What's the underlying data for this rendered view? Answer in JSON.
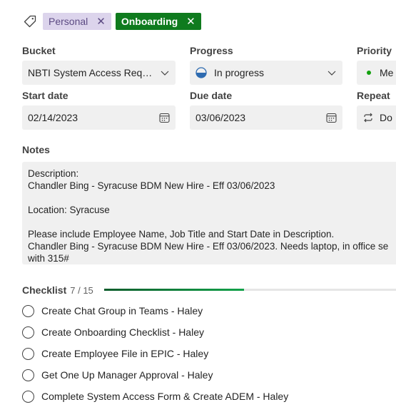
{
  "labels": [
    {
      "text": "Personal",
      "remove_icon": "close-icon"
    },
    {
      "text": "Onboarding",
      "remove_icon": "close-icon"
    }
  ],
  "fields": {
    "bucket": {
      "label": "Bucket",
      "value": "NBTI System Access Reque..."
    },
    "progress": {
      "label": "Progress",
      "value": "In progress"
    },
    "priority": {
      "label": "Priority",
      "value": "Me"
    },
    "start_date": {
      "label": "Start date",
      "value": "02/14/2023"
    },
    "due_date": {
      "label": "Due date",
      "value": "03/06/2023"
    },
    "repeat": {
      "label": "Repeat",
      "value": "Do"
    }
  },
  "notes": {
    "label": "Notes",
    "text": "Description:\nChandler Bing - Syracuse BDM New Hire - Eff 03/06/2023\n\nLocation: Syracuse\n\nPlease include Employee Name, Job Title and Start Date in Description.\nChandler Bing - Syracuse BDM New Hire - Eff 03/06/2023. Needs laptop, in office se\nwith 315#"
  },
  "checklist": {
    "title": "Checklist",
    "count": "7 / 15",
    "completed": 7,
    "total": 15,
    "items": [
      "Create Chat Group in Teams - Haley",
      "Create Onboarding Checklist - Haley",
      "Create Employee File in EPIC - Haley",
      "Get One Up Manager Approval - Haley",
      "Complete System Access Form & Create ADEM - Haley"
    ]
  },
  "colors": {
    "onboarding_chip": "#0f7b1e",
    "personal_chip": "#dcd4ec",
    "progress_fill": "#13a24a",
    "priority_dot": "#13a10e"
  }
}
